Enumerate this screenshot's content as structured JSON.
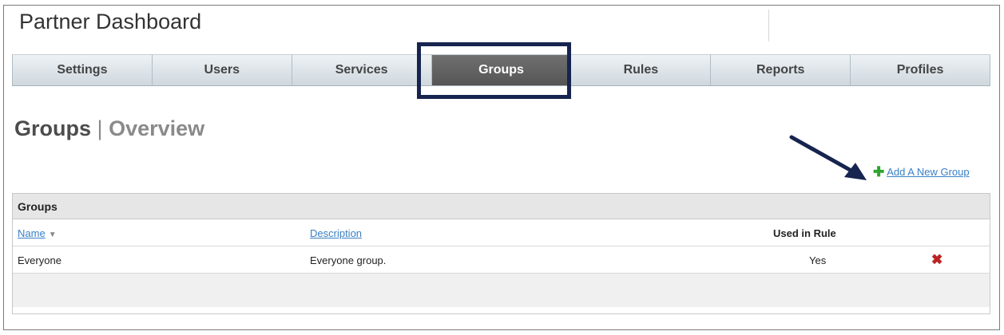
{
  "app": {
    "title": "Partner Dashboard"
  },
  "tabs": [
    {
      "label": "Settings",
      "active": false
    },
    {
      "label": "Users",
      "active": false
    },
    {
      "label": "Services",
      "active": false
    },
    {
      "label": "Groups",
      "active": true
    },
    {
      "label": "Rules",
      "active": false
    },
    {
      "label": "Reports",
      "active": false
    },
    {
      "label": "Profiles",
      "active": false
    }
  ],
  "page": {
    "title": "Groups",
    "separator": "|",
    "subtitle": "Overview"
  },
  "actions": {
    "add_label": "Add A New Group",
    "add_icon": "plus-icon"
  },
  "table": {
    "title": "Groups",
    "columns": {
      "name": "Name",
      "description": "Description",
      "used": "Used in Rule"
    },
    "rows": [
      {
        "name": "Everyone",
        "description": "Everyone group.",
        "used": "Yes",
        "action_icon": "delete-icon"
      }
    ]
  },
  "colors": {
    "highlight_box": "#16244f",
    "link": "#3a7fc4",
    "active_tab": "#5f5f5f",
    "plus": "#2ea52e",
    "delete": "#c02020"
  }
}
